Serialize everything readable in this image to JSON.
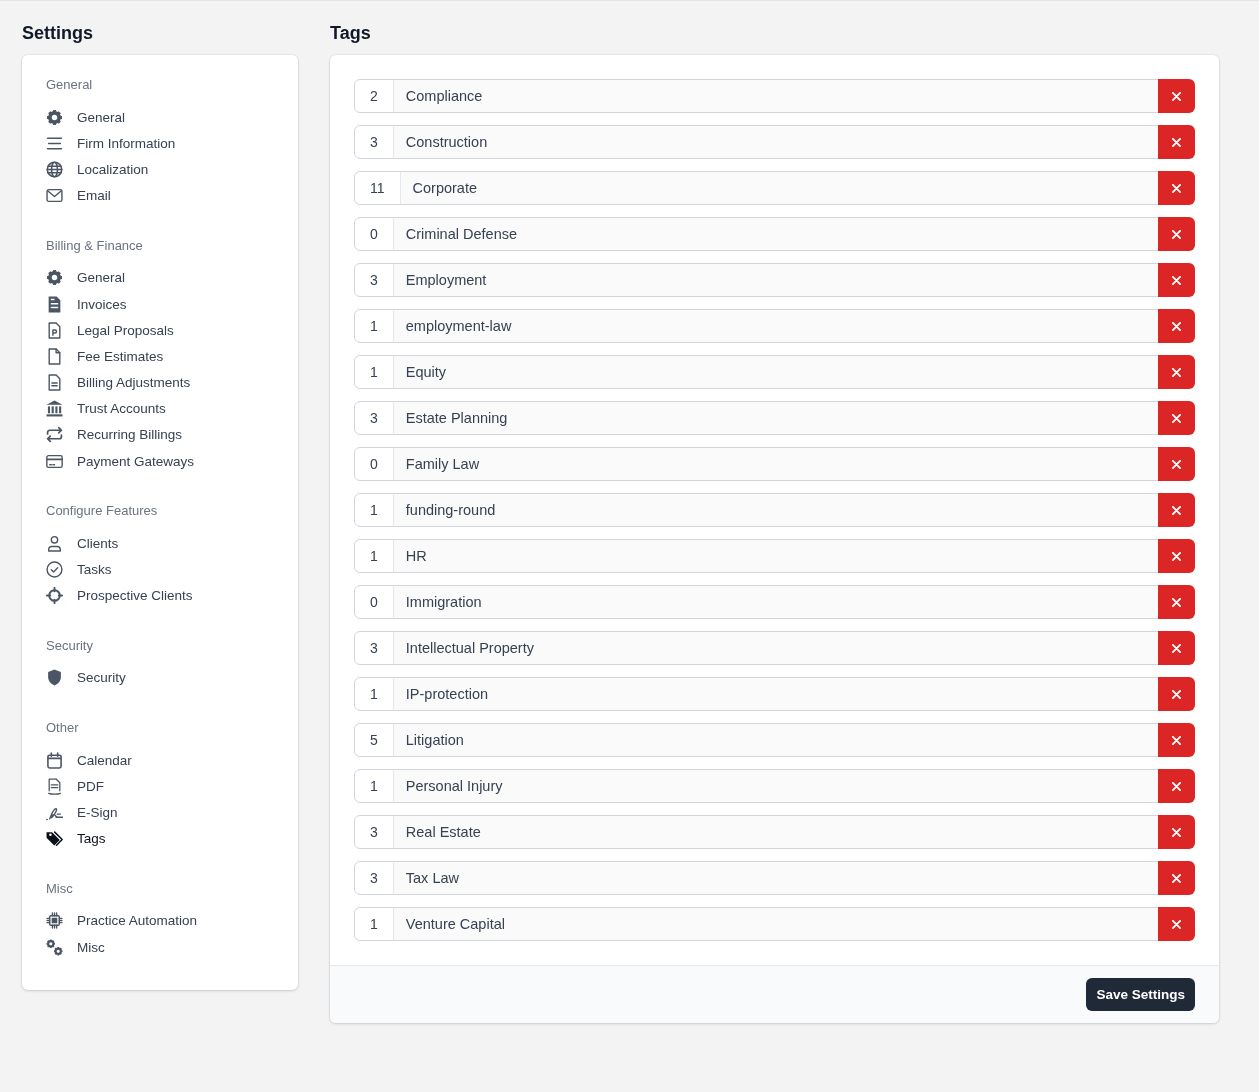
{
  "sidebar": {
    "title": "Settings",
    "sections": [
      {
        "label": "General",
        "items": [
          {
            "label": "General",
            "selected": false
          },
          {
            "label": "Firm Information",
            "selected": false
          },
          {
            "label": "Localization",
            "selected": false
          },
          {
            "label": "Email",
            "selected": false
          }
        ]
      },
      {
        "label": "Billing & Finance",
        "items": [
          {
            "label": "General",
            "selected": false
          },
          {
            "label": "Invoices",
            "selected": false
          },
          {
            "label": "Legal Proposals",
            "selected": false
          },
          {
            "label": "Fee Estimates",
            "selected": false
          },
          {
            "label": "Billing Adjustments",
            "selected": false
          },
          {
            "label": "Trust Accounts",
            "selected": false
          },
          {
            "label": "Recurring Billings",
            "selected": false
          },
          {
            "label": "Payment Gateways",
            "selected": false
          }
        ]
      },
      {
        "label": "Configure Features",
        "items": [
          {
            "label": "Clients",
            "selected": false
          },
          {
            "label": "Tasks",
            "selected": false
          },
          {
            "label": "Prospective Clients",
            "selected": false
          }
        ]
      },
      {
        "label": "Security",
        "items": [
          {
            "label": "Security",
            "selected": false
          }
        ]
      },
      {
        "label": "Other",
        "items": [
          {
            "label": "Calendar",
            "selected": false
          },
          {
            "label": "PDF",
            "selected": false
          },
          {
            "label": "E-Sign",
            "selected": false
          },
          {
            "label": "Tags",
            "selected": true
          }
        ]
      },
      {
        "label": "Misc",
        "items": [
          {
            "label": "Practice Automation",
            "selected": false
          },
          {
            "label": "Misc",
            "selected": false
          }
        ]
      }
    ]
  },
  "main": {
    "title": "Tags",
    "tags": [
      {
        "count": "2",
        "name": "Compliance"
      },
      {
        "count": "3",
        "name": "Construction"
      },
      {
        "count": "11",
        "name": "Corporate"
      },
      {
        "count": "0",
        "name": "Criminal Defense"
      },
      {
        "count": "3",
        "name": "Employment"
      },
      {
        "count": "1",
        "name": "employment-law"
      },
      {
        "count": "1",
        "name": "Equity"
      },
      {
        "count": "3",
        "name": "Estate Planning"
      },
      {
        "count": "0",
        "name": "Family Law"
      },
      {
        "count": "1",
        "name": "funding-round"
      },
      {
        "count": "1",
        "name": "HR"
      },
      {
        "count": "0",
        "name": "Immigration"
      },
      {
        "count": "3",
        "name": "Intellectual Property"
      },
      {
        "count": "1",
        "name": "IP-protection"
      },
      {
        "count": "5",
        "name": "Litigation"
      },
      {
        "count": "1",
        "name": "Personal Injury"
      },
      {
        "count": "3",
        "name": "Real Estate"
      },
      {
        "count": "3",
        "name": "Tax Law"
      },
      {
        "count": "1",
        "name": "Venture Capital"
      }
    ],
    "save_button": "Save Settings"
  }
}
